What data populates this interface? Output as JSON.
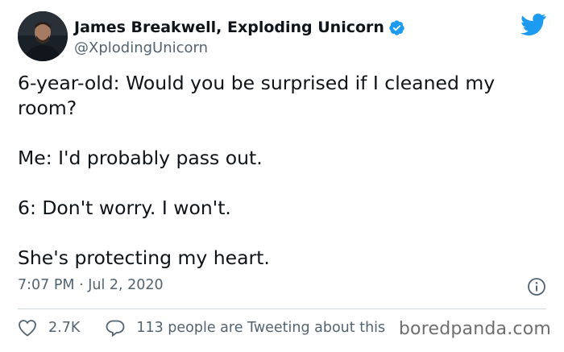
{
  "author": {
    "display_name": "James Breakwell, Exploding Unicorn",
    "handle": "@XplodingUnicorn",
    "verified": true,
    "avatar_icon": "profile-photo-avatar"
  },
  "tweet": {
    "paragraphs": [
      "6-year-old: Would you be surprised if I cleaned my room?",
      "Me: I'd probably pass out.",
      "6: Don't worry. I won't.",
      "She's protecting my heart."
    ],
    "timestamp": "7:07 PM · Jul 2, 2020"
  },
  "actions": {
    "like_count": "2.7K",
    "reply_text": "113 people are Tweeting about this"
  },
  "watermark": "boredpanda.com",
  "colors": {
    "twitter_blue": "#1d9bf0",
    "text_primary": "#0f1419",
    "text_secondary": "#536471",
    "divider": "#cfd9de"
  },
  "icons": {
    "brand": "twitter-bird-icon",
    "verified": "verified-badge-icon",
    "info": "info-icon",
    "like": "heart-icon",
    "reply": "speech-bubble-icon"
  }
}
